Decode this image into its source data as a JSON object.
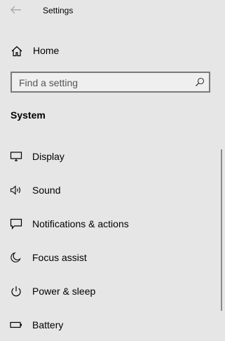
{
  "header": {
    "title": "Settings",
    "back_icon": "back-arrow-icon"
  },
  "home": {
    "label": "Home",
    "icon": "home-icon"
  },
  "search": {
    "placeholder": "Find a setting",
    "icon": "search-icon"
  },
  "section": {
    "title": "System"
  },
  "nav": {
    "items": [
      {
        "label": "Display",
        "icon": "display-icon"
      },
      {
        "label": "Sound",
        "icon": "speaker-icon"
      },
      {
        "label": "Notifications & actions",
        "icon": "notification-icon"
      },
      {
        "label": "Focus assist",
        "icon": "moon-icon"
      },
      {
        "label": "Power & sleep",
        "icon": "power-icon"
      },
      {
        "label": "Battery",
        "icon": "battery-icon"
      }
    ]
  },
  "colors": {
    "background": "#e6e6e6",
    "search_border": "#7a7a7a",
    "scrollbar": "#8a8a8a"
  }
}
